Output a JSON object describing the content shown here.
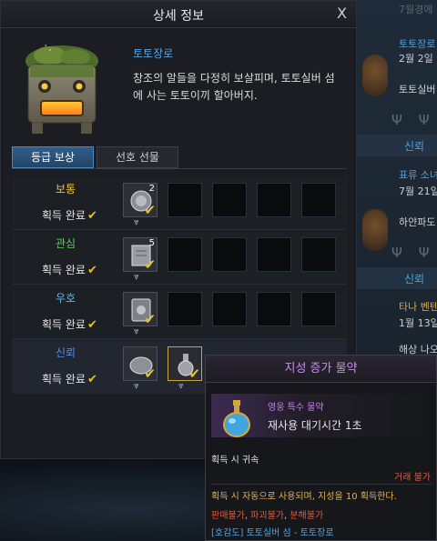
{
  "background": {
    "entries": [
      {
        "name": "토토장로",
        "date": "2월 2일",
        "desc": "토토실버"
      },
      {
        "name": "표류 소녀",
        "date": "7월 21일",
        "desc": "하얀파도"
      },
      {
        "name": "타나 벤텐",
        "date": "1월 13일",
        "desc": "해상 나오"
      }
    ],
    "bands": [
      "신뢰",
      "신뢰"
    ],
    "top_faded": "7월경에"
  },
  "dialog": {
    "title": "상세 정보",
    "close_label": "X",
    "npc": {
      "name": "토토장로",
      "description": "창조의 알들을 다정히 보살피며, 토토실버 섬에 사는 토토이끼 할아버지."
    },
    "tabs": [
      {
        "label": "등급 보상",
        "active": true
      },
      {
        "label": "선호 선물",
        "active": false
      }
    ],
    "tiers": [
      {
        "name": "보통",
        "color": "#e8c14a",
        "status": "획득 완료",
        "qty": "2"
      },
      {
        "name": "관심",
        "color": "#5ccf5a",
        "status": "획득 완료",
        "qty": "5"
      },
      {
        "name": "우호",
        "color": "#5ab9e6",
        "status": "획득 완료",
        "qty": ""
      },
      {
        "name": "신뢰",
        "color": "#4f91e8",
        "status": "획득 완료",
        "qty": ""
      }
    ]
  },
  "tooltip": {
    "title": "지성 증가 물약",
    "category": "영웅 특수 물약",
    "cooldown": "재사용 대기시간 1초",
    "bind": "획득 시 귀속",
    "trade": "거래 불가",
    "effect": "획득 시 자동으로 사용되며, 지성을 10 획득한다.",
    "restrictions": [
      "판매불가",
      "파괴불가",
      "분해불가"
    ],
    "source": "[호감도] 토토실버 섬 - 토토장로",
    "colors": {
      "title": "#c98bf0",
      "category": "#c77ff0",
      "trade": "#e05a3a",
      "effect": "#e8b24a",
      "restriction": "#e05a3a",
      "source": "#4fa6e6"
    }
  }
}
